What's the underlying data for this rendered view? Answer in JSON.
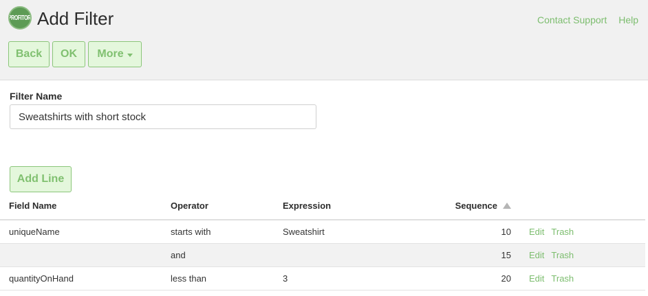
{
  "header": {
    "logo_text": "PROFITORI",
    "title": "Add Filter",
    "links": [
      "Contact Support",
      "Help"
    ]
  },
  "toolbar": {
    "back_label": "Back",
    "ok_label": "OK",
    "more_label": "More"
  },
  "form": {
    "filter_name_label": "Filter Name",
    "filter_name_value": "Sweatshirts with short stock"
  },
  "add_line_label": "Add Line",
  "table": {
    "columns": [
      "Field Name",
      "Operator",
      "Expression",
      "Sequence"
    ],
    "sort_column": "Sequence",
    "sort_direction": "ascending",
    "rows": [
      {
        "field": "uniqueName",
        "operator": "starts with",
        "expression": "Sweatshirt",
        "sequence": "10",
        "edit": "Edit",
        "trash": "Trash"
      },
      {
        "field": "",
        "operator": "and",
        "expression": "",
        "sequence": "15",
        "edit": "Edit",
        "trash": "Trash"
      },
      {
        "field": "quantityOnHand",
        "operator": "less than",
        "expression": "3",
        "sequence": "20",
        "edit": "Edit",
        "trash": "Trash"
      }
    ]
  },
  "colors": {
    "accent_green": "#7cbd6e",
    "button_bg": "#e4f7dc",
    "button_border": "#8ac579",
    "header_bg": "#f1f1f1",
    "logo_green": "#5d9b55"
  }
}
